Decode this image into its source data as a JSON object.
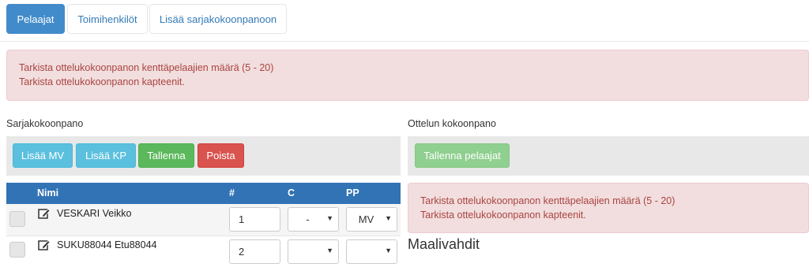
{
  "tabs": [
    {
      "label": "Pelaajat",
      "active": true
    },
    {
      "label": "Toimihenkilöt",
      "active": false
    },
    {
      "label": "Lisää sarjakokoonpanoon",
      "active": false
    }
  ],
  "top_alert": {
    "line1": "Tarkista ottelukokoonpanon kenttäpelaajien määrä (5 - 20)",
    "line2": "Tarkista ottelukokoonpanon kapteenit."
  },
  "left": {
    "heading": "Sarjakokoonpano",
    "buttons": {
      "add_mv": "Lisää MV",
      "add_kp": "Lisää KP",
      "save": "Tallenna",
      "delete": "Poista"
    },
    "table": {
      "headers": {
        "name": "Nimi",
        "number": "#",
        "c": "C",
        "pp": "PP"
      },
      "rows": [
        {
          "name": "VESKARI Veikko",
          "number": "1",
          "c": "-",
          "pp": "MV"
        },
        {
          "name": "SUKU88044 Etu88044",
          "number": "2",
          "c": "",
          "pp": ""
        }
      ]
    }
  },
  "right": {
    "heading": "Ottelun kokoonpano",
    "save_players": "Tallenna pelaajat",
    "alert": {
      "line1": "Tarkista ottelukokoonpanon kenttäpelaajien määrä (5 - 20)",
      "line2": "Tarkista ottelukokoonpanon kapteenit."
    },
    "section_heading": "Maalivahdit"
  },
  "colors": {
    "primary": "#428bca",
    "alert_bg": "#f2dede",
    "alert_text": "#a94442",
    "table_header": "#3173b5",
    "info": "#5bc0de",
    "success": "#5cb85c",
    "danger": "#d9534f"
  },
  "icons": {
    "edit": "edit-pencil-icon",
    "caret": "caret-down-icon"
  }
}
